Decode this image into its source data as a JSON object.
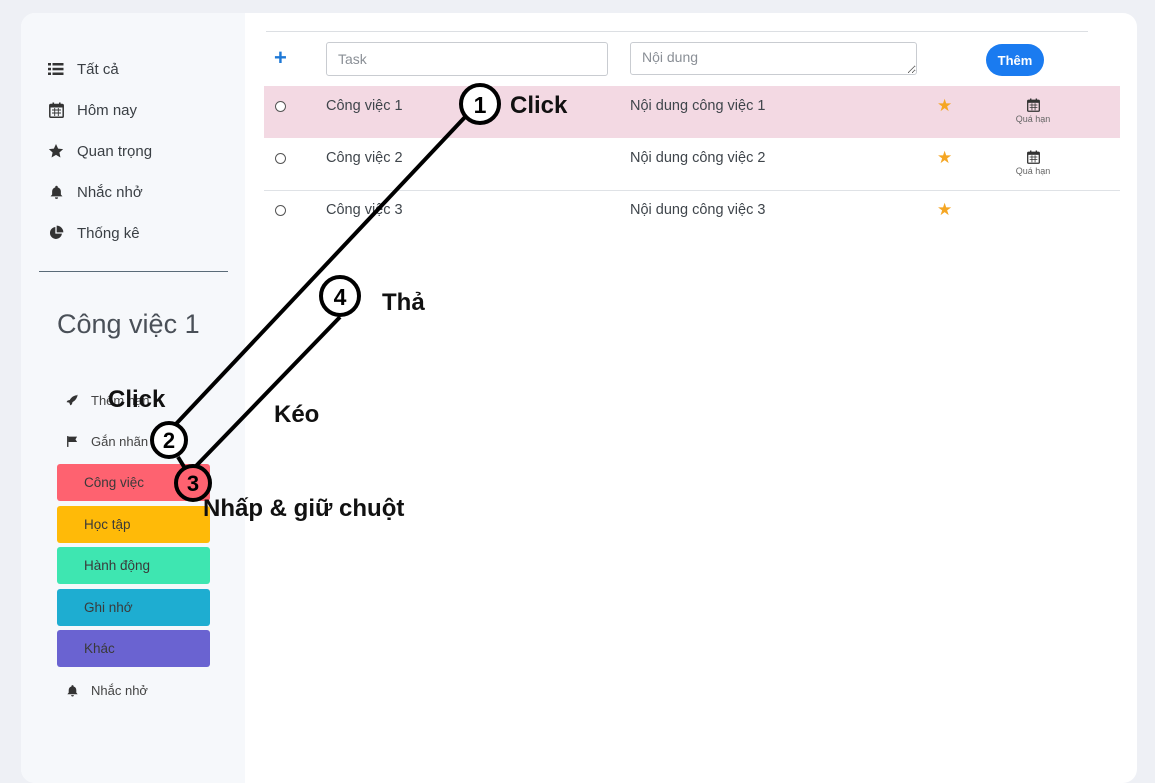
{
  "sidebar": {
    "items": [
      {
        "label": "Tất cả",
        "icon": "list-icon"
      },
      {
        "label": "Hôm nay",
        "icon": "calendar-icon"
      },
      {
        "label": "Quan trọng",
        "icon": "star-icon"
      },
      {
        "label": "Nhắc nhở",
        "icon": "bell-icon"
      },
      {
        "label": "Thống kê",
        "icon": "pie-chart-icon"
      }
    ]
  },
  "detail": {
    "title": "Công việc 1",
    "actions": {
      "deadline_label": "Thêm hạn",
      "tag_label": "Gắn nhãn",
      "reminder_label": "Nhắc nhở"
    },
    "tags": [
      {
        "label": "Công việc",
        "color": "#fe6270"
      },
      {
        "label": "Học tập",
        "color": "#ffba08"
      },
      {
        "label": "Hành động",
        "color": "#3ee6b1"
      },
      {
        "label": "Ghi nhớ",
        "color": "#1eadd1"
      },
      {
        "label": "Khác",
        "color": "#6a63d1"
      }
    ]
  },
  "form": {
    "task_placeholder": "Task",
    "content_placeholder": "Nội dung",
    "add_label": "Thêm"
  },
  "tasks": [
    {
      "title": "Công việc 1",
      "content": "Nội dung công việc 1",
      "starred": true,
      "due_label": "Quá hạn",
      "selected": true
    },
    {
      "title": "Công việc 2",
      "content": "Nội dung công việc 2",
      "starred": true,
      "due_label": "Quá hạn",
      "selected": false
    },
    {
      "title": "Công việc 3",
      "content": "Nội dung công việc 3",
      "starred": true,
      "due_label": "",
      "selected": false
    }
  ],
  "annotations": {
    "step1": "1",
    "step1_text": "Click",
    "step2": "2",
    "step2_text": "Click",
    "step3": "3",
    "step3_text": "Nhấp & giữ chuột",
    "step4": "4",
    "step4_text": "Thả",
    "drag_text": "Kéo"
  },
  "colors": {
    "accent": "#1a7bf0",
    "star": "#f5a623",
    "selected_row": "#f3d9e3"
  }
}
